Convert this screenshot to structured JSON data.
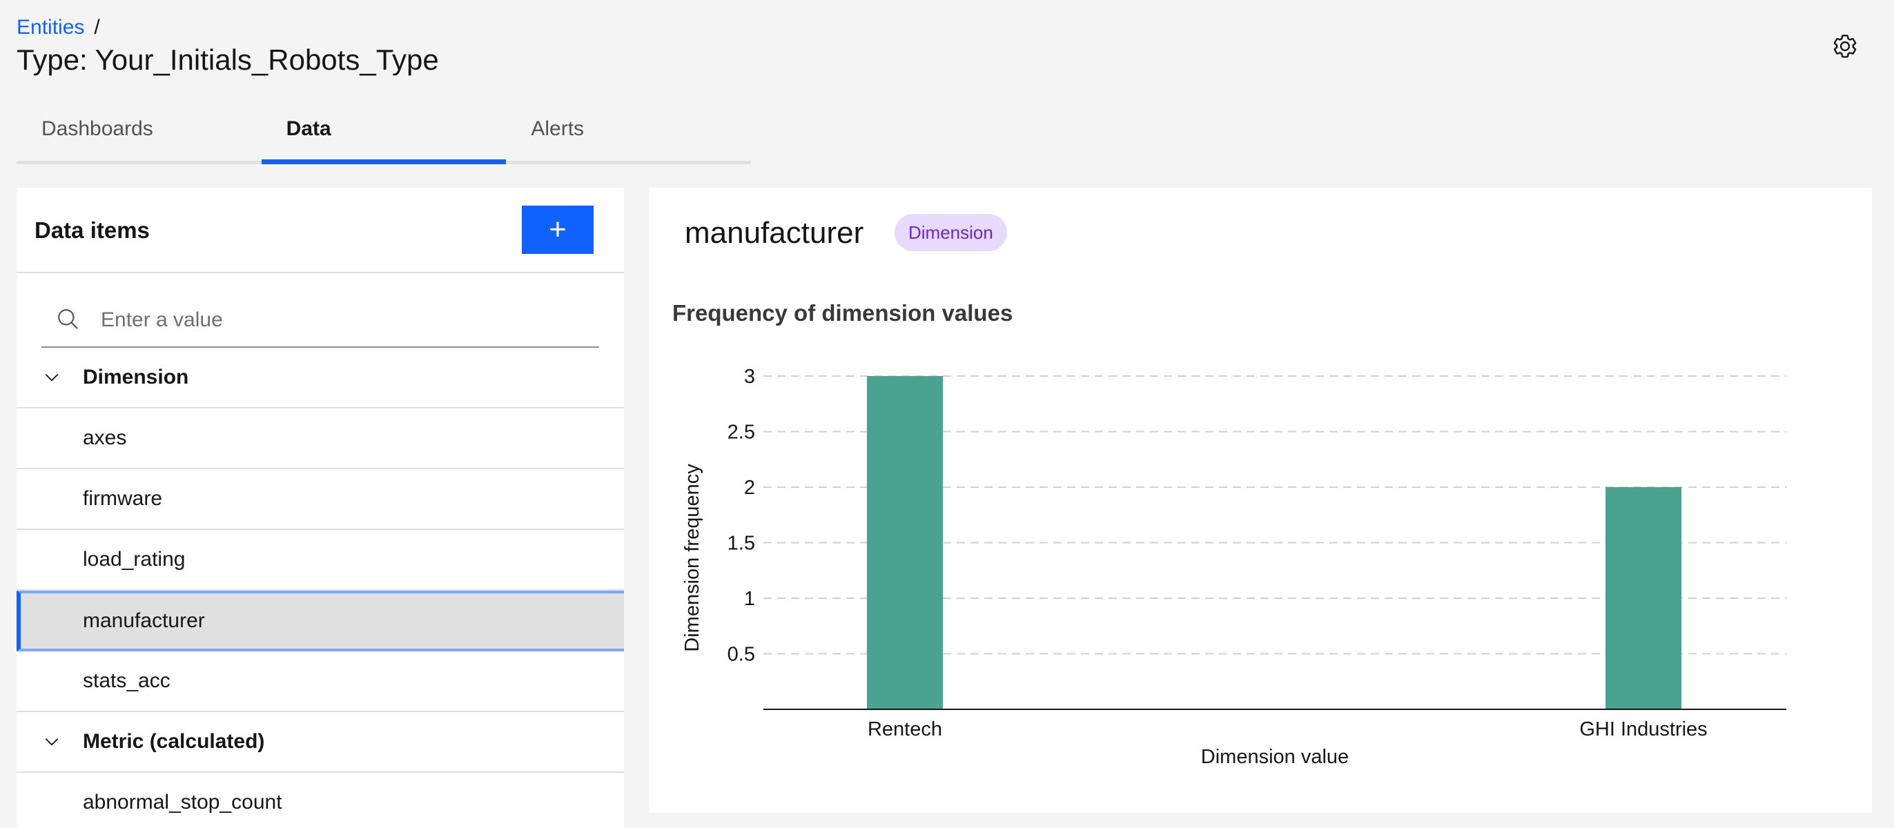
{
  "breadcrumb": {
    "link": "Entities",
    "separator": "/"
  },
  "page_title": "Type: Your_Initials_Robots_Type",
  "tabs": [
    {
      "label": "Dashboards",
      "active": false
    },
    {
      "label": "Data",
      "active": true
    },
    {
      "label": "Alerts",
      "active": false
    }
  ],
  "data_items": {
    "title": "Data items",
    "add_button": "+",
    "search_placeholder": "Enter a value",
    "groups": [
      {
        "label": "Dimension",
        "expanded": true,
        "items": [
          "axes",
          "firmware",
          "load_rating",
          "manufacturer",
          "stats_acc"
        ]
      },
      {
        "label": "Metric (calculated)",
        "expanded": true,
        "items": [
          "abnormal_stop_count"
        ]
      }
    ],
    "selected": "manufacturer"
  },
  "detail": {
    "name": "manufacturer",
    "tag": "Dimension"
  },
  "colors": {
    "accent": "#0f62fe",
    "bar": "#4aa390",
    "tag_bg": "#e8daff",
    "tag_text": "#6929c4"
  },
  "icons": [
    "gear-icon",
    "search-icon",
    "chevron-down-icon",
    "plus-icon"
  ],
  "chart_data": {
    "type": "bar",
    "title": "Frequency of dimension values",
    "categories": [
      "Rentech",
      "GHI Industries"
    ],
    "values": [
      3,
      2
    ],
    "xlabel": "Dimension value",
    "ylabel": "Dimension frequency",
    "yticks": [
      "0.5",
      "1",
      "1.5",
      "2",
      "2.5",
      "3"
    ],
    "ylim": [
      0,
      3
    ],
    "grid": true
  }
}
